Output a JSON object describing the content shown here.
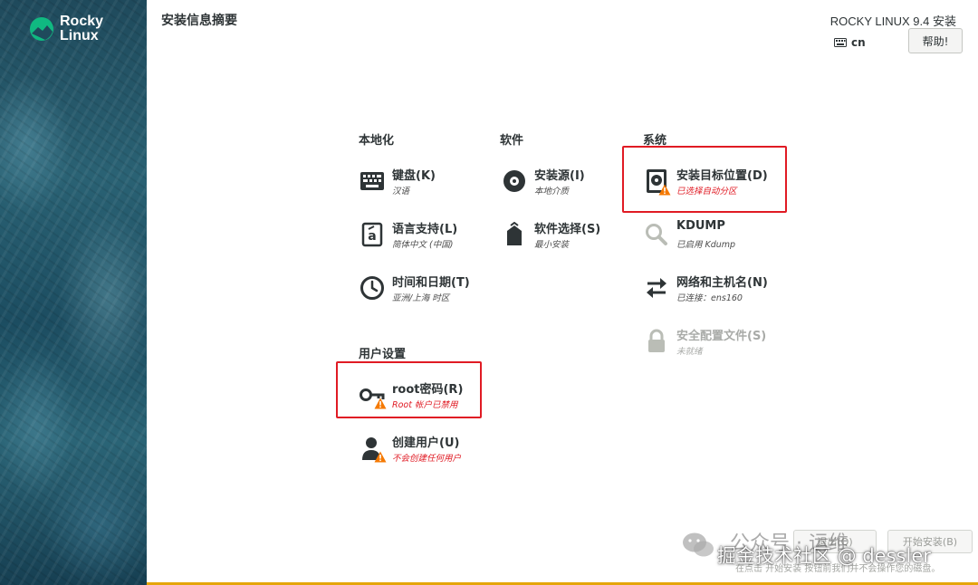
{
  "sidebar": {
    "logo_line1": "Rocky",
    "logo_line2": "Linux"
  },
  "header": {
    "page_title": "安装信息摘要",
    "product_title": "ROCKY LINUX 9.4 安装",
    "keyboard_layout": "cn",
    "help_label": "帮助!"
  },
  "categories": {
    "localization": {
      "title": "本地化",
      "items": [
        {
          "title": "键盘(K)",
          "status": "汉语",
          "icon": "keyboard-icon"
        },
        {
          "title": "语言支持(L)",
          "status": "简体中文 (中国)",
          "icon": "language-icon"
        },
        {
          "title": "时间和日期(T)",
          "status": "亚洲/上海 时区",
          "icon": "clock-icon"
        }
      ]
    },
    "software": {
      "title": "软件",
      "items": [
        {
          "title": "安装源(I)",
          "status": "本地介质",
          "icon": "disc-icon"
        },
        {
          "title": "软件选择(S)",
          "status": "最小安装",
          "icon": "package-icon"
        }
      ]
    },
    "system": {
      "title": "系统",
      "items": [
        {
          "title": "安装目标位置(D)",
          "status": "已选择自动分区",
          "icon": "disk-icon",
          "warning": true
        },
        {
          "title": "KDUMP",
          "status": "已启用 Kdump",
          "icon": "magnifier-icon"
        },
        {
          "title": "网络和主机名(N)",
          "status": "已连接：ens160",
          "icon": "network-arrows-icon"
        },
        {
          "title": "安全配置文件(S)",
          "status": "未就绪",
          "icon": "lock-icon",
          "disabled": true
        }
      ]
    },
    "user_settings": {
      "title": "用户设置",
      "items": [
        {
          "title": "root密码(R)",
          "status": "Root 帐户已禁用",
          "icon": "key-icon",
          "warning": true
        },
        {
          "title": "创建用户(U)",
          "status": "不会创建任何用户",
          "icon": "user-icon",
          "warning": true
        }
      ]
    }
  },
  "footer": {
    "quit_label": "退出(Q)",
    "begin_label": "开始安装(B)",
    "hint": "在点击 开始安装 按钮前我们并不会操作您的磁盘。"
  },
  "watermark": {
    "line1": "公众号 · 运维",
    "line2": "掘金技术社区 @ dessler"
  },
  "colors": {
    "warning_red": "#e01b24",
    "progress_bar": "#e5a50a",
    "highlight_box": "#e01b24"
  }
}
